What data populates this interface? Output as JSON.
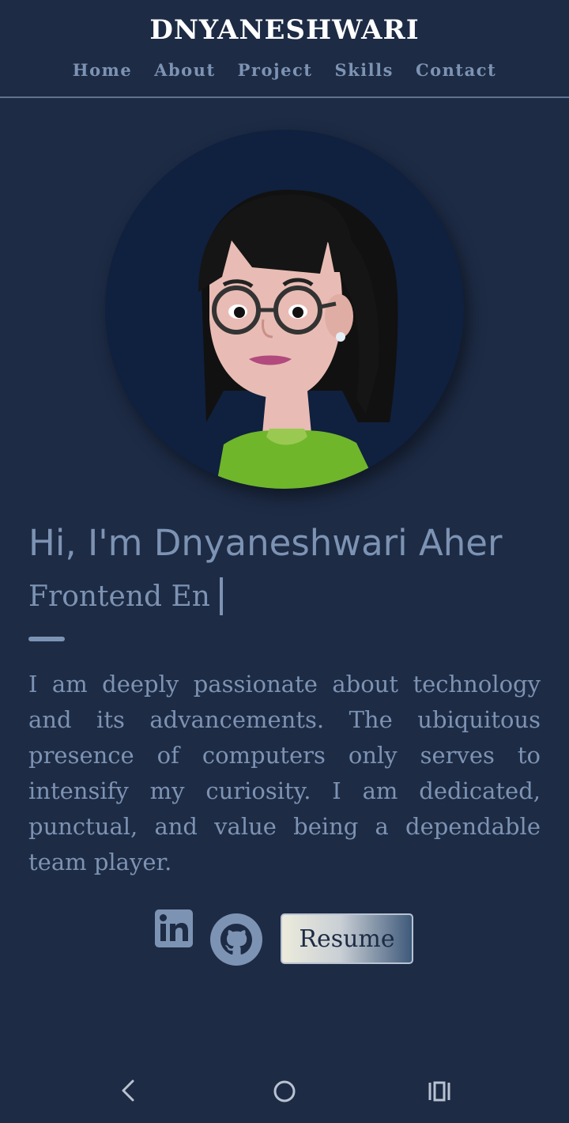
{
  "header": {
    "brand": "DNYANESHWARI",
    "nav": [
      "Home",
      "About",
      "Project",
      "Skills",
      "Contact"
    ]
  },
  "hero": {
    "headline": "Hi, I'm Dnyaneshwari Aher",
    "subline": "Frontend En",
    "bio": "I am deeply passionate about technology and its advancements. The ubiquitous presence of computers only serves to intensify my curiosity. I am dedicated, punctual, and value being a dependable team player."
  },
  "social": {
    "icons": [
      "linkedin-icon",
      "github-icon"
    ],
    "resume_label": "Resume"
  },
  "system_nav": {
    "icons": [
      "back-icon",
      "home-icon",
      "recent-apps-icon"
    ]
  },
  "colors": {
    "background": "#1d2b45",
    "text": "#7d93b3",
    "avatar_background": "#10203f",
    "brand": "#ffffff"
  }
}
